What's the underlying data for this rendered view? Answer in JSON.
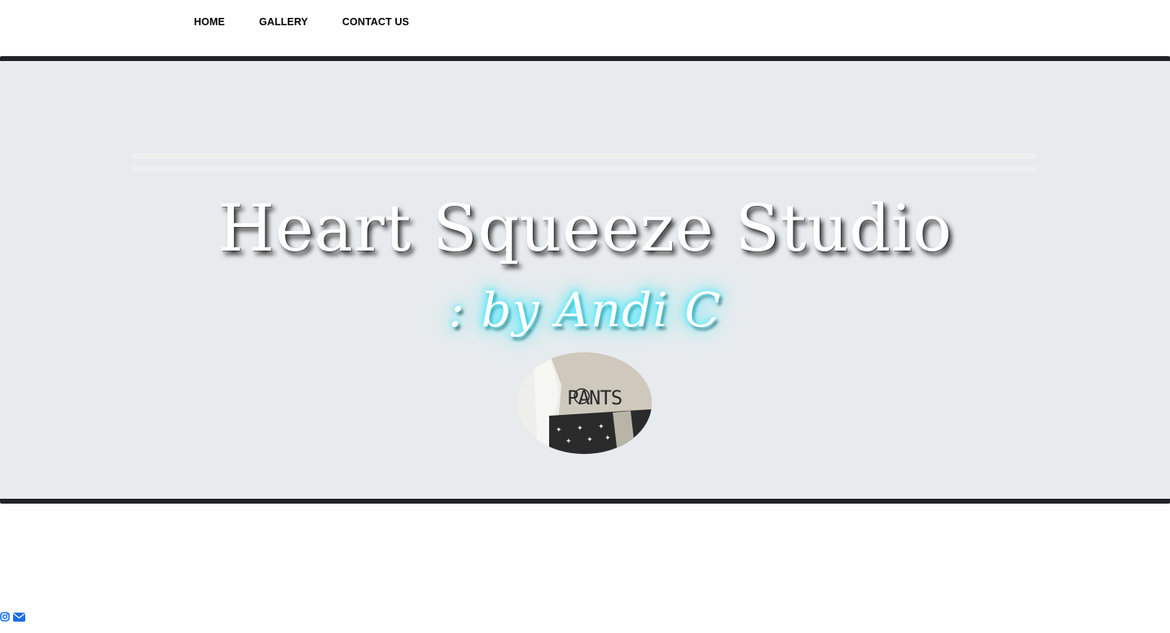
{
  "nav": {
    "items": [
      {
        "label": "HOME"
      },
      {
        "label": "GALLERY"
      },
      {
        "label": "CONTACT US"
      }
    ]
  },
  "hero": {
    "title": "Heart Squeeze Studio",
    "subtitle": ": by Andi C",
    "photo": {
      "tattoo_text": "PANTS"
    }
  },
  "footer": {
    "icons": [
      "instagram-icon",
      "envelope-icon"
    ],
    "icon_color": "#1a6fe8"
  },
  "colors": {
    "hero_background": "#e7ebee",
    "hero_border": "#1f2327",
    "glow": "#2ee6ff"
  }
}
